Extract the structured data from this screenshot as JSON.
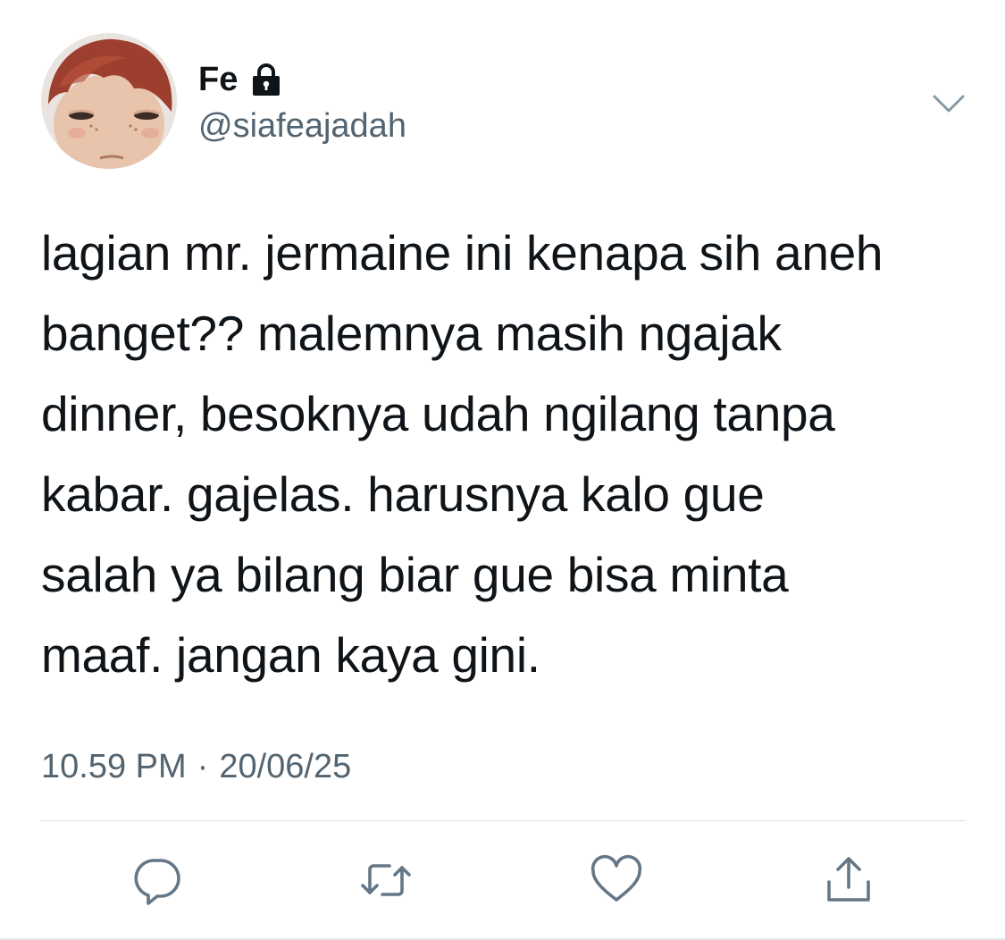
{
  "author": {
    "display_name": "Fe",
    "handle": "@siafeajadah",
    "protected_icon": "lock-icon",
    "avatar_icon": "avatar-doll-image"
  },
  "menu": {
    "icon": "chevron-down-icon"
  },
  "tweet": {
    "lines": [
      "lagian mr. jermaine ini kenapa sih aneh",
      "banget?? malemnya masih ngajak",
      "dinner, besoknya udah ngilang tanpa",
      "kabar. gajelas. harusnya kalo gue",
      "salah ya bilang biar gue bisa minta",
      "maaf. jangan kaya gini."
    ],
    "time": "10.59 PM",
    "separator": "·",
    "date": "20/06/25"
  },
  "actions": [
    {
      "icon": "reply-icon"
    },
    {
      "icon": "retweet-icon"
    },
    {
      "icon": "like-icon"
    },
    {
      "icon": "share-icon"
    }
  ],
  "colors": {
    "text": "#0f1419",
    "secondary": "#536471",
    "icon": "#657786",
    "divider": "#dcdfe3"
  }
}
